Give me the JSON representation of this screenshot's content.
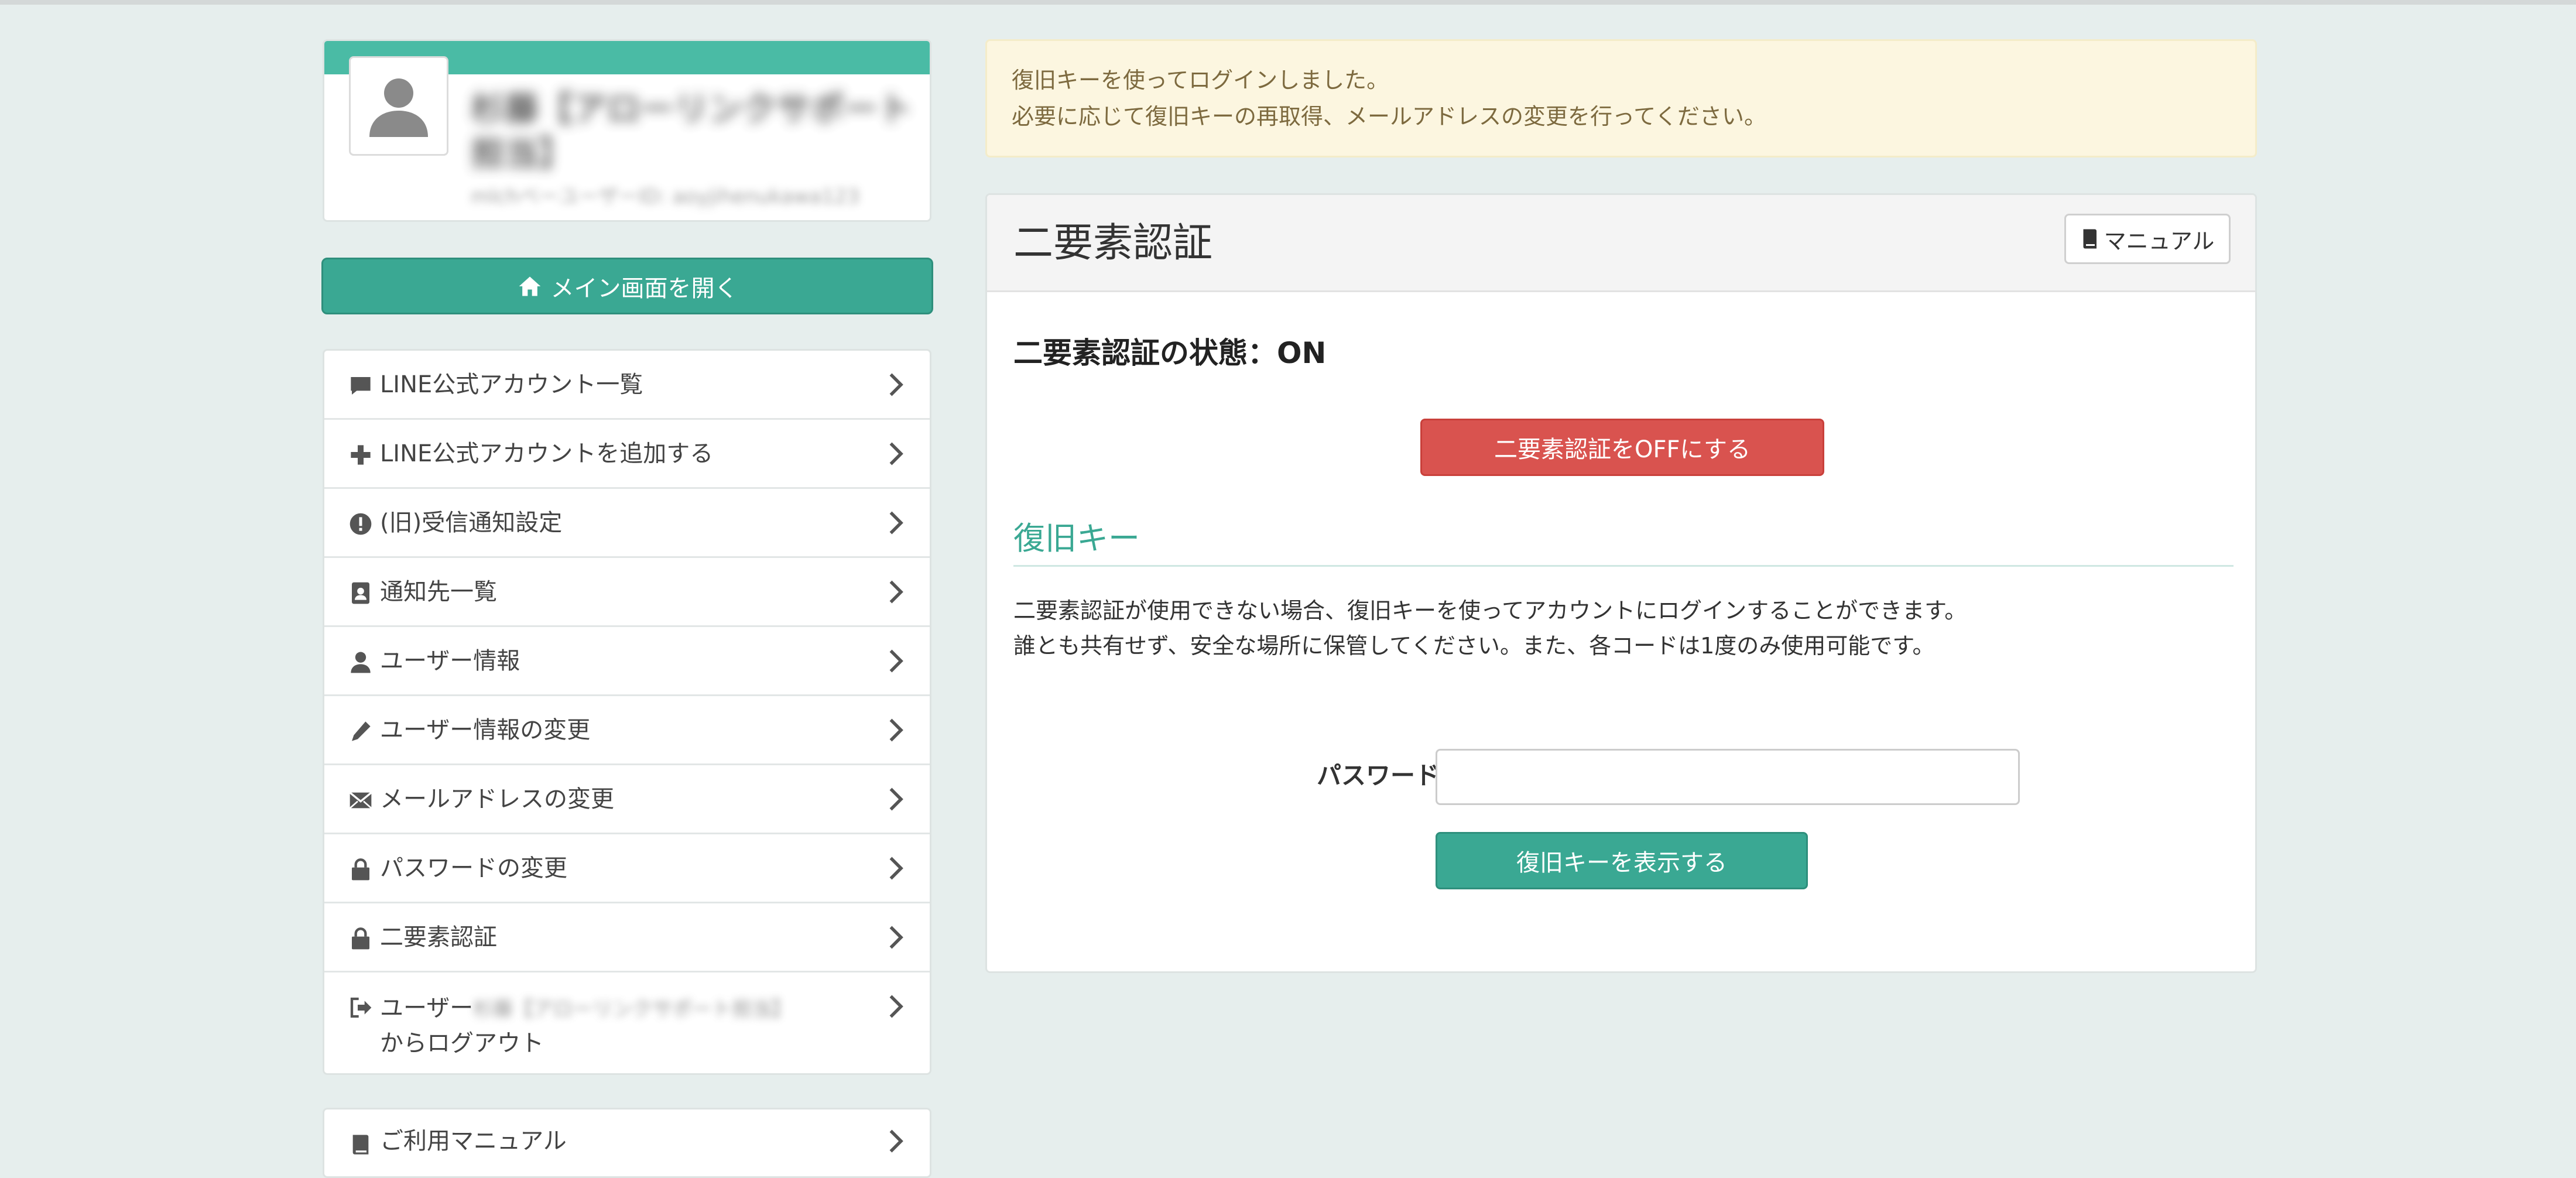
{
  "profile": {
    "name": "杉藤【アローリンクサポート担当】",
    "user_id": "mlchベーユーザーID: aoyjihenukawa123"
  },
  "sidebar": {
    "main_button": "メイン画面を開く",
    "items": [
      {
        "label": "LINE公式アカウント一覧",
        "icon": "comment-icon"
      },
      {
        "label": "LINE公式アカウントを追加する",
        "icon": "plus-icon"
      },
      {
        "label": "(旧)受信通知設定",
        "icon": "exclamation-circle-icon"
      },
      {
        "label": "通知先一覧",
        "icon": "contact-card-icon"
      },
      {
        "label": "ユーザー情報",
        "icon": "user-icon"
      },
      {
        "label": "ユーザー情報の変更",
        "icon": "pencil-icon"
      },
      {
        "label": "メールアドレスの変更",
        "icon": "envelope-icon"
      },
      {
        "label": "パスワードの変更",
        "icon": "lock-icon"
      },
      {
        "label": "二要素認証",
        "icon": "lock-icon"
      }
    ],
    "logout": {
      "prefix": "ユーザー",
      "blurred_name": "杉藤【アローリンクサポート担当】",
      "suffix": "からログアウト",
      "icon": "sign-out-icon"
    },
    "manual": {
      "label": "ご利用マニュアル",
      "icon": "book-icon"
    }
  },
  "alert": {
    "line1": "復旧キーを使ってログインしました。",
    "line2": "必要に応じて復旧キーの再取得、メールアドレスの変更を行ってください。"
  },
  "panel": {
    "title": "二要素認証",
    "manual_button": "マニュアル",
    "status": "二要素認証の状態：ON",
    "off_button": "二要素認証をOFFにする",
    "section_title": "復旧キー",
    "desc_line1": "二要素認証が使用できない場合、復旧キーを使ってアカウントにログインすることができます。",
    "desc_line2": "誰とも共有せず、安全な場所に保管してください。また、各コードは1度のみ使用可能です。",
    "password_label": "パスワード",
    "password_value": "",
    "show_button": "復旧キーを表示する"
  },
  "colors": {
    "accent": "#3aa893",
    "danger": "#d9534f",
    "alert_bg": "#fcf6e0",
    "page_bg": "#e6eeed"
  }
}
